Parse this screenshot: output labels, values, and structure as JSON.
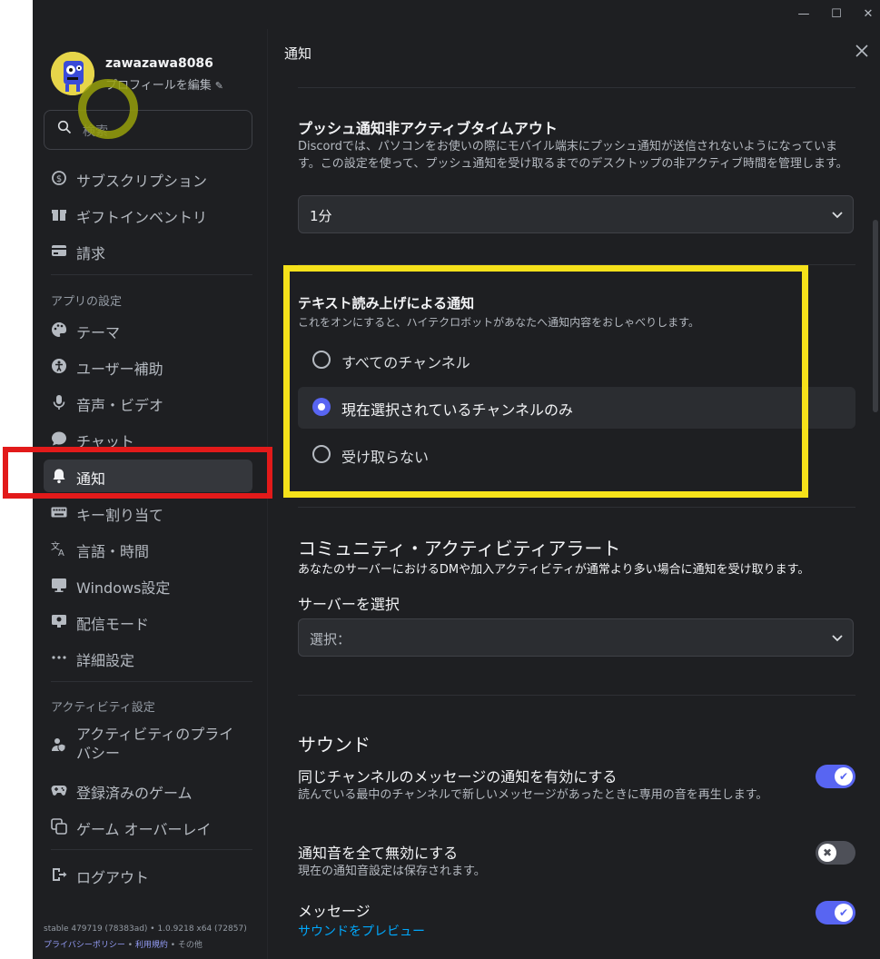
{
  "window": {
    "controls": {
      "minimize": "—",
      "maximize": "☐",
      "close": "✕"
    }
  },
  "profile": {
    "username": "zawazawa8086",
    "edit_label": "プロフィールを編集",
    "edit_icon": "pencil-icon"
  },
  "search": {
    "placeholder": "検索"
  },
  "sidebar": {
    "billing_items": [
      {
        "label": "サブスクリプション",
        "icon": "subscription-icon"
      },
      {
        "label": "ギフトインベントリ",
        "icon": "gift-icon"
      },
      {
        "label": "請求",
        "icon": "card-icon"
      }
    ],
    "app_settings_heading": "アプリの設定",
    "app_items": [
      {
        "label": "テーマ",
        "icon": "palette-icon"
      },
      {
        "label": "ユーザー補助",
        "icon": "accessibility-icon"
      },
      {
        "label": "音声・ビデオ",
        "icon": "microphone-icon"
      },
      {
        "label": "チャット",
        "icon": "chat-icon"
      },
      {
        "label": "通知",
        "icon": "bell-icon",
        "active": true
      },
      {
        "label": "キー割り当て",
        "icon": "keyboard-icon"
      },
      {
        "label": "言語・時間",
        "icon": "language-icon"
      },
      {
        "label": "Windows設定",
        "icon": "monitor-icon"
      },
      {
        "label": "配信モード",
        "icon": "streamer-icon"
      },
      {
        "label": "詳細設定",
        "icon": "more-icon"
      }
    ],
    "activity_heading": "アクティビティ設定",
    "activity_items": [
      {
        "label": "アクティビティのプライバシー",
        "icon": "privacy-icon"
      },
      {
        "label": "登録済みのゲーム",
        "icon": "gamepad-icon"
      },
      {
        "label": "ゲーム オーバーレイ",
        "icon": "overlay-icon"
      }
    ],
    "logout_label": "ログアウト",
    "footer": {
      "version": "stable 479719 (78383ad) • 1.0.9218 x64 (72857)",
      "privacy": "プライバシーポリシー",
      "sep1": " • ",
      "terms": "利用規約",
      "sep2": " • ",
      "other": "その他"
    }
  },
  "main": {
    "title": "通知",
    "push_timeout": {
      "heading": "プッシュ通知非アクティブタイムアウト",
      "description": "Discordでは、パソコンをお使いの際にモバイル端末にプッシュ通知が送信されないようになっています。この設定を使って、プッシュ通知を受け取るまでのデスクトップの非アクティブ時間を管理します。",
      "selected": "1分"
    },
    "tts": {
      "heading": "テキスト読み上げによる通知",
      "description": "これをオンにすると、ハイテクロボットがあなたへ通知内容をおしゃべりします。",
      "options": [
        {
          "label": "すべてのチャンネル",
          "selected": false
        },
        {
          "label": "現在選択されているチャンネルのみ",
          "selected": true
        },
        {
          "label": "受け取らない",
          "selected": false
        }
      ]
    },
    "community": {
      "heading": "コミュニティ・アクティビティアラート",
      "description": "あなたのサーバーにおけるDMや加入アクティビティが通常より多い場合に通知を受け取ります。",
      "server_label": "サーバーを選択",
      "select_placeholder": "選択："
    },
    "sound": {
      "heading": "サウンド",
      "same_channel": {
        "label": "同じチャンネルのメッセージの通知を有効にする",
        "description": "読んでいる最中のチャンネルで新しいメッセージがあったときに専用の音を再生します。",
        "enabled": true
      },
      "disable_all": {
        "label": "通知音を全て無効にする",
        "description": "現在の通知音設定は保存されます。",
        "enabled": false
      },
      "message": {
        "label": "メッセージ",
        "preview_link": "サウンドをプレビュー",
        "enabled": true
      }
    }
  },
  "colors": {
    "accent": "#5865f2",
    "annotation_red": "#e21a1a",
    "annotation_yellow": "#f5e11a"
  }
}
